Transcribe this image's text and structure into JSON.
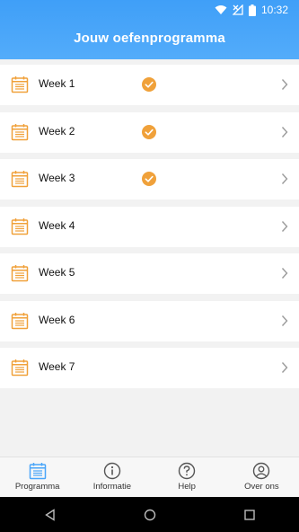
{
  "status": {
    "time": "10:32"
  },
  "header": {
    "title": "Jouw oefenprogramma"
  },
  "weeks": [
    {
      "label": "Week 1",
      "completed": true
    },
    {
      "label": "Week 2",
      "completed": true
    },
    {
      "label": "Week 3",
      "completed": true
    },
    {
      "label": "Week 4",
      "completed": false
    },
    {
      "label": "Week 5",
      "completed": false
    },
    {
      "label": "Week 6",
      "completed": false
    },
    {
      "label": "Week 7",
      "completed": false
    }
  ],
  "nav": {
    "programma": "Programma",
    "informatie": "Informatie",
    "help": "Help",
    "over_ons": "Over ons"
  },
  "colors": {
    "accent": "#4aa6f9",
    "orange": "#f0a13a",
    "header_top": "#3f9ff8"
  }
}
